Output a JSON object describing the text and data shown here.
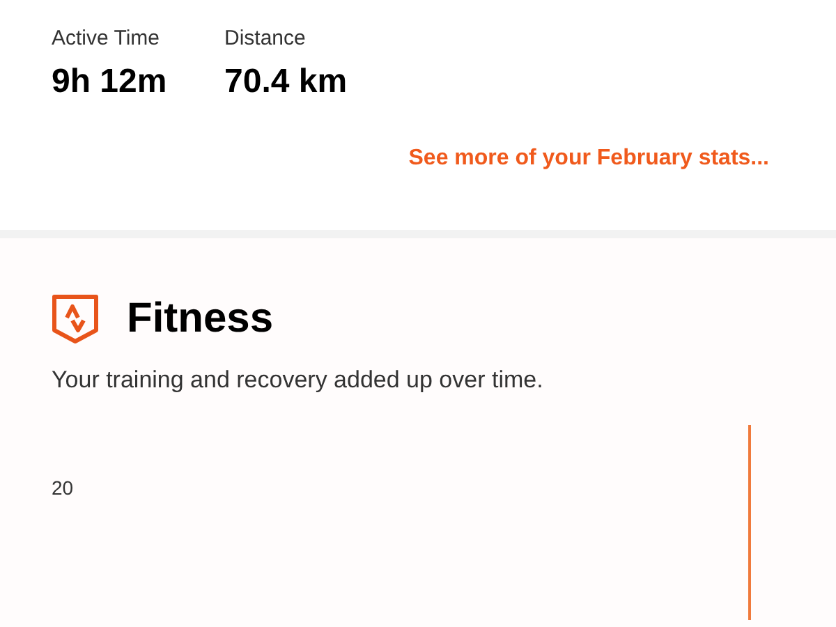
{
  "stats": [
    {
      "label": "Active Time",
      "value": "9h 12m"
    },
    {
      "label": "Distance",
      "value": "70.4 km"
    }
  ],
  "stats_link": "See more of your February stats...",
  "fitness": {
    "title": "Fitness",
    "subtitle": "Your training and recovery added up over time.",
    "chart": {
      "axis_label": "20"
    }
  }
}
